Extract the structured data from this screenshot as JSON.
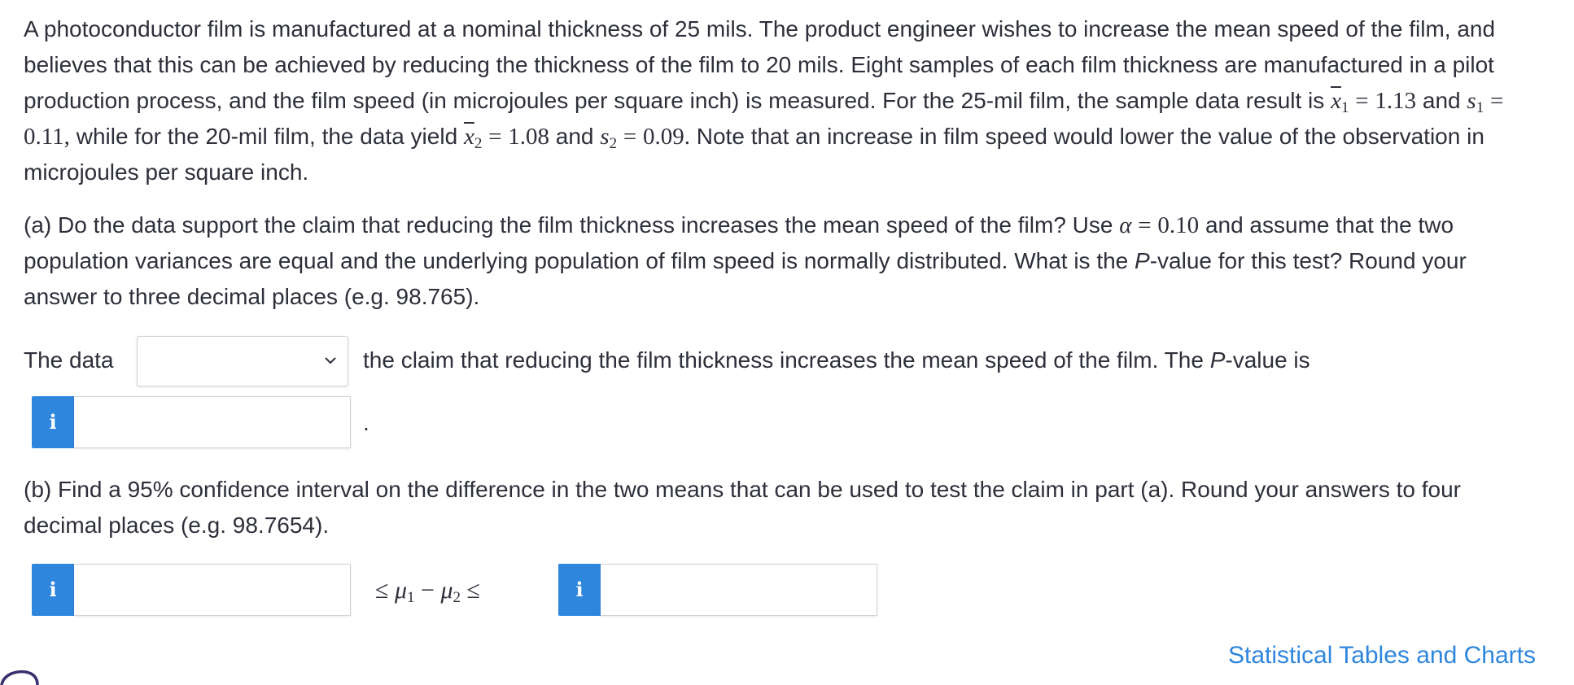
{
  "problem": {
    "intro": "A photoconductor film is manufactured at a nominal thickness of 25 mils. The product engineer wishes to increase the mean speed of the film, and believes that this can be achieved by reducing the thickness of the film to 20 mils. Eight samples of each film thickness are manufactured in a pilot production process, and the film speed (in microjoules per square inch) is measured. For the 25-mil film, the sample data result is",
    "x1_symbol": "x",
    "x1_sub": "1",
    "equals": "=",
    "x1_value": "1.13",
    "and1": "and",
    "s1_symbol": "s",
    "s1_sub": "1",
    "s1_value": "0.11,",
    "while_text": "while for the 20-mil film, the data yield",
    "x2_symbol": "x",
    "x2_sub": "2",
    "x2_value": "1.08",
    "and2": "and",
    "s2_symbol": "s",
    "s2_sub": "2",
    "s2_value": "0.09.",
    "note": "Note that an increase in film speed would lower the value of the observation in microjoules per square inch."
  },
  "part_a": {
    "text_before_alpha": "(a) Do the data support the claim that reducing the film thickness increases the mean speed of the film? Use",
    "alpha_symbol": "α",
    "alpha_value": "0.10",
    "text_after_alpha": "and assume that the two population variances are equal and the underlying population of film speed is normally distributed. What is the",
    "p_italic": "P",
    "text_end": "-value for this test? Round your answer to three decimal places (e.g. 98.765)."
  },
  "answer_a": {
    "lead": "The data",
    "select_value": "",
    "after_select": "the claim that reducing the film thickness increases the mean speed of the film. The",
    "p_italic": "P",
    "after_p": "-value is",
    "info_label": "i",
    "p_value_input": "",
    "period": "."
  },
  "part_b": {
    "text": "(b) Find a 95% confidence interval on the difference in the two means that can be used to test the claim in part (a). Round your answers to four decimal places (e.g. 98.7654)."
  },
  "answer_b": {
    "info_label_lower": "i",
    "lower_input": "",
    "leq1": "≤",
    "mu1": "μ",
    "mu1_sub": "1",
    "minus": "−",
    "mu2": "μ",
    "mu2_sub": "2",
    "leq2": "≤",
    "info_label_upper": "i",
    "upper_input": ""
  },
  "footer": {
    "link_label": "Statistical Tables and Charts"
  },
  "colors": {
    "accent": "#2f86dd",
    "text": "#2d2f3a",
    "border": "#cfd2d8"
  }
}
